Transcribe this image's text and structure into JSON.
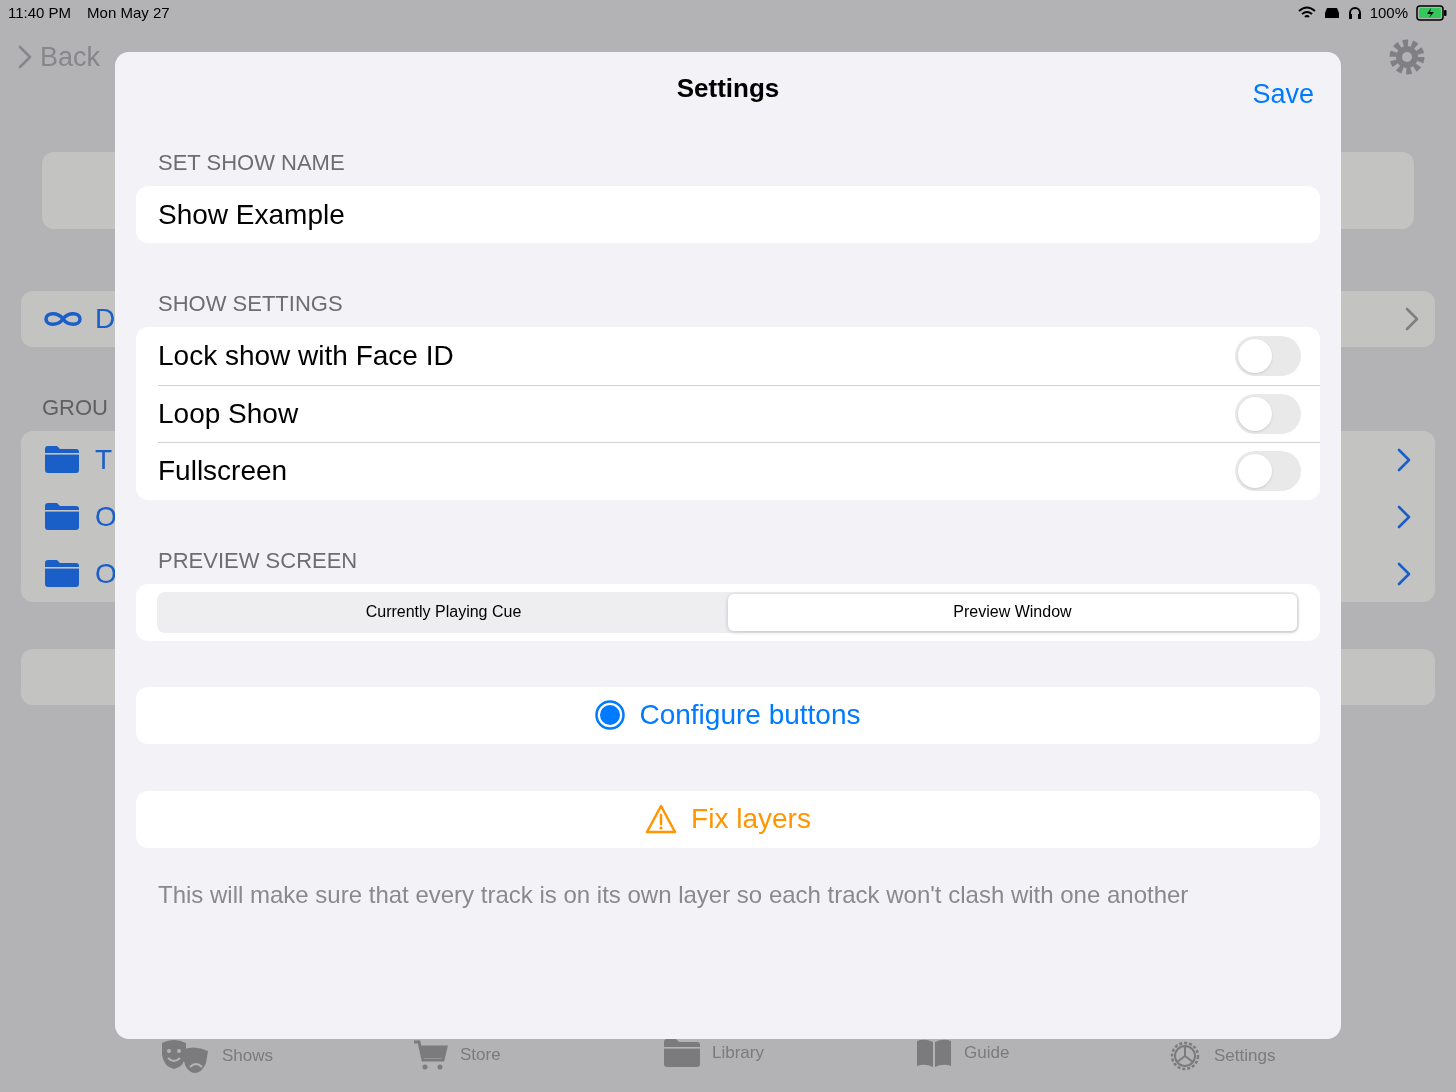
{
  "status_bar": {
    "time": "11:40 PM",
    "date": "Mon May 27",
    "battery": "100%"
  },
  "nav": {
    "back": "Back"
  },
  "backdrop": {
    "first_row": "D",
    "group_header": "GROU",
    "groups": [
      {
        "label": "T"
      },
      {
        "label": "O"
      },
      {
        "label": "O"
      }
    ]
  },
  "sheet": {
    "title": "Settings",
    "save": "Save",
    "name_section": {
      "header": "SET SHOW NAME",
      "value": "Show Example"
    },
    "settings_section": {
      "header": "SHOW SETTINGS",
      "toggles": [
        {
          "label": "Lock show with Face ID",
          "on": false
        },
        {
          "label": "Loop Show",
          "on": false
        },
        {
          "label": "Fullscreen",
          "on": false
        }
      ]
    },
    "preview_section": {
      "header": "PREVIEW SCREEN",
      "segments": [
        {
          "label": "Currently Playing Cue",
          "selected": false
        },
        {
          "label": "Preview Window",
          "selected": true
        }
      ]
    },
    "configure_button": "Configure buttons",
    "fix_button": "Fix layers",
    "footnote": "This will make sure that every track is on its own layer so each track won't clash with one another"
  },
  "tab_bar": {
    "items": [
      {
        "kind": "shows",
        "label": "Shows"
      },
      {
        "kind": "store",
        "label": "Store"
      },
      {
        "kind": "library",
        "label": "Library"
      },
      {
        "kind": "guide",
        "label": "Guide"
      },
      {
        "kind": "settings",
        "label": "Settings"
      }
    ]
  }
}
